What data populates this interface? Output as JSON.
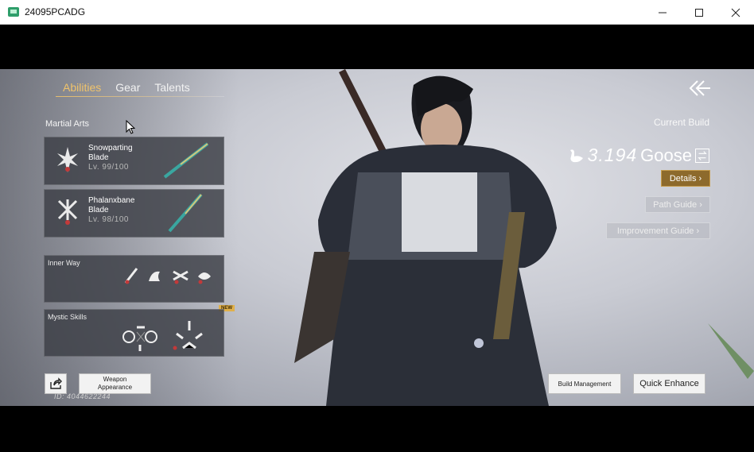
{
  "window": {
    "title": "24095PCADG",
    "minimize_icon": "minimize-icon",
    "maximize_icon": "maximize-icon",
    "close_icon": "close-icon"
  },
  "tabs": [
    {
      "label": "Abilities",
      "active": true
    },
    {
      "label": "Gear",
      "active": false
    },
    {
      "label": "Talents",
      "active": false
    }
  ],
  "martial_arts": {
    "label": "Martial Arts",
    "items": [
      {
        "name": "Snowparting Blade",
        "level": "Lv. 99/100"
      },
      {
        "name": "Phalanxbane Blade",
        "level": "Lv. 98/100"
      }
    ]
  },
  "inner_way": {
    "label": "Inner Way"
  },
  "mystic_skills": {
    "label": "Mystic Skills",
    "badge": "NEW"
  },
  "build": {
    "current_label": "Current Build",
    "score": "3.194",
    "name": "Goose",
    "details": "Details ›",
    "path_guide": "Path Guide ›",
    "improvement_guide": "Improvement Guide ›"
  },
  "bottom": {
    "weapon_appearance": "Weapon Appearance",
    "id": "ID: 4044622244",
    "build_management": "Build Management",
    "quick_enhance": "Quick Enhance"
  },
  "colors": {
    "accent_gold": "#f0c36b",
    "details_btn": "#8d6a2c"
  }
}
